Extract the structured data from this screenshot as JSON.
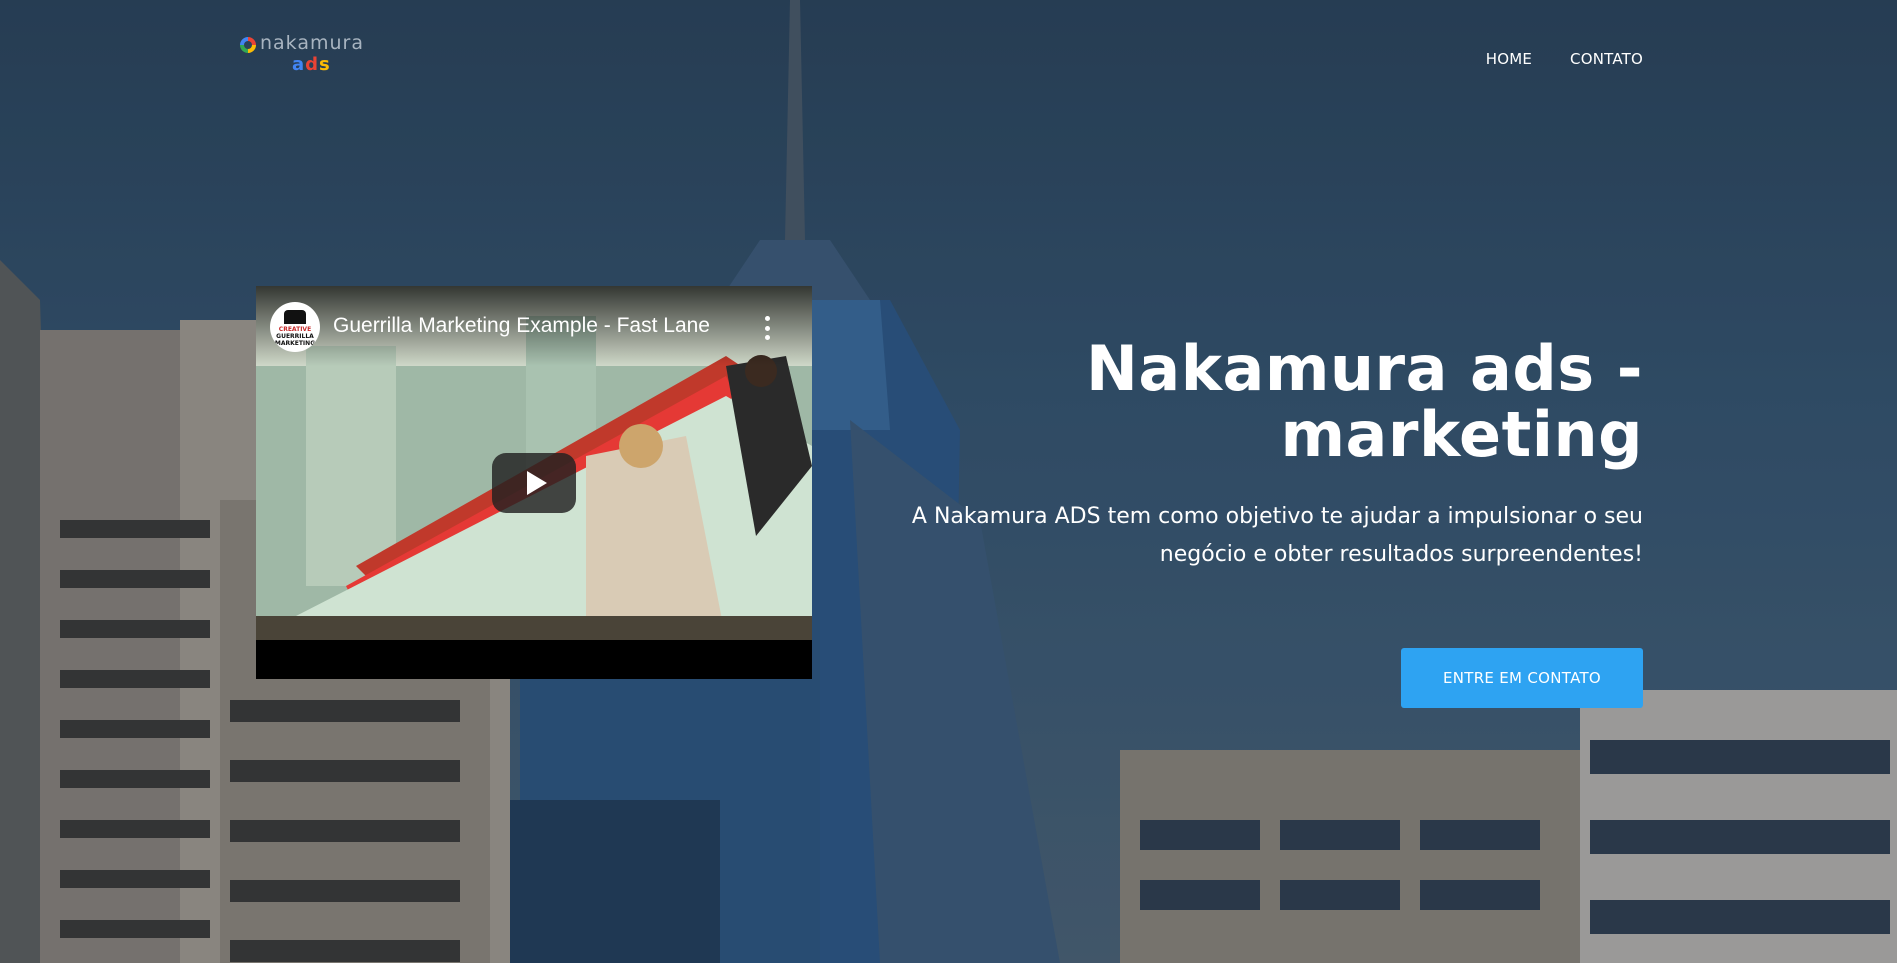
{
  "brand": {
    "logo_word": "nakamura",
    "logo_sub": [
      "a",
      "d",
      "s"
    ]
  },
  "nav": {
    "items": [
      {
        "label": "HOME"
      },
      {
        "label": "CONTATO"
      }
    ]
  },
  "video": {
    "title": "Guerrilla Marketing Example - Fast Lane",
    "channel_avatar_text": [
      "CREATIVE",
      "GUERRILLA",
      "MARKETING"
    ]
  },
  "hero": {
    "title_line1": "Nakamura ads -",
    "title_line2": "marketing",
    "subtitle_line1": "A Nakamura ADS tem como objetivo te ajudar a impulsionar o seu",
    "subtitle_line2": "negócio e obter resultados surpreendentes!",
    "cta_label": "ENTRE EM CONTATO"
  },
  "colors": {
    "accent": "#2ea3f2",
    "sky": "#2f4b63",
    "logo_blue": "#4285f4",
    "logo_red": "#ea4335",
    "logo_yellow": "#fbbc05",
    "logo_green": "#34a853"
  },
  "icons": {
    "logo_ring": "google-style-ring-icon",
    "video_menu": "more-vertical-icon",
    "video_play": "play-icon"
  }
}
